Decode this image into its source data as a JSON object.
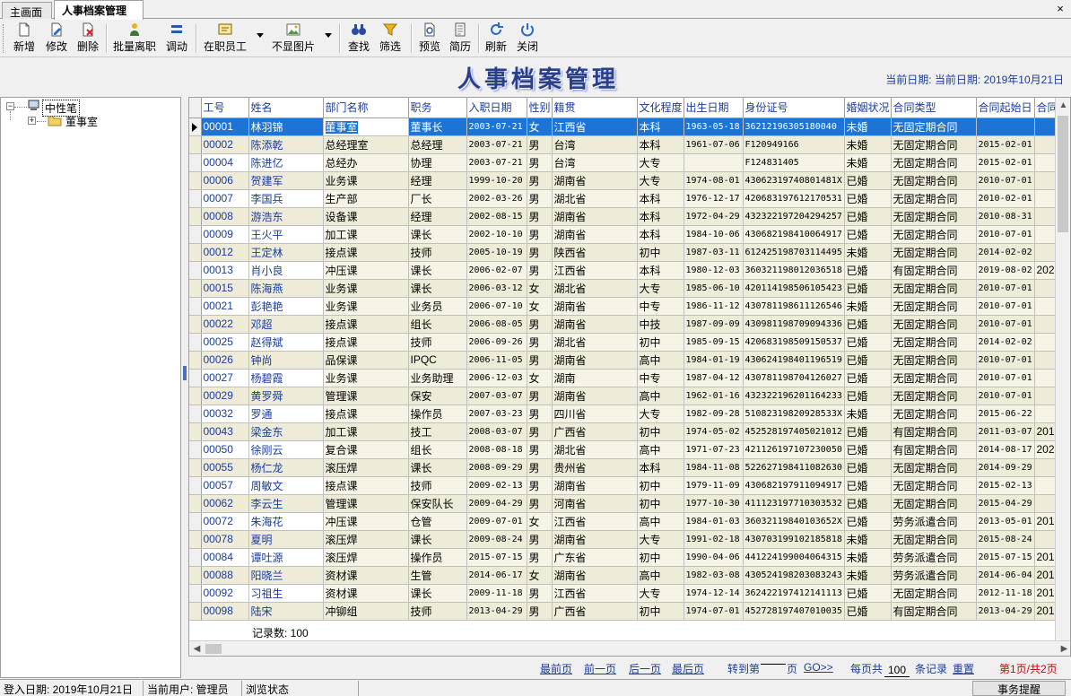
{
  "tabs": [
    "主画面",
    "人事档案管理"
  ],
  "close_glyph": "×",
  "toolbar": {
    "buttons": [
      {
        "label": "新增",
        "icon": "new-doc-icon"
      },
      {
        "label": "修改",
        "icon": "edit-doc-icon"
      },
      {
        "label": "删除",
        "icon": "delete-doc-icon"
      },
      {
        "label": "批量离职",
        "icon": "batch-leave-icon"
      },
      {
        "label": "调动",
        "icon": "transfer-icon"
      },
      {
        "label": "在职员工",
        "icon": "employee-status-icon"
      },
      {
        "label": "不显图片",
        "icon": "image-icon"
      },
      {
        "label": "查找",
        "icon": "binoculars-icon"
      },
      {
        "label": "筛选",
        "icon": "filter-icon"
      },
      {
        "label": "预览",
        "icon": "preview-icon"
      },
      {
        "label": "简历",
        "icon": "resume-icon"
      },
      {
        "label": "刷新",
        "icon": "refresh-icon"
      },
      {
        "label": "关闭",
        "icon": "power-icon"
      }
    ]
  },
  "banner": {
    "title": "人事档案管理",
    "current_date": "当前日期:  当前日期: 2019年10月21日"
  },
  "tree": {
    "root": "中性笔",
    "child": "董事室"
  },
  "grid": {
    "columns": [
      "工号",
      "姓名",
      "部门名称",
      "职务",
      "入职日期",
      "性别",
      "籍贯",
      "文化程度",
      "出生日期",
      "身份证号",
      "婚姻状况",
      "合同类型",
      "合同起始日",
      "合同"
    ],
    "rows": [
      [
        "00001",
        "林羽锦",
        "董事室",
        "董事长",
        "2003-07-21",
        "女",
        "江西省",
        "本科",
        "1963-05-18",
        "362121963051800​40",
        "未婚",
        "无固定期合同",
        "",
        ""
      ],
      [
        "00002",
        "陈添乾",
        "总经理室",
        "总经理",
        "2003-07-21",
        "男",
        "台湾",
        "本科",
        "1961-07-06",
        "F120949166",
        "未婚",
        "无固定期合同",
        "2015-02-01",
        ""
      ],
      [
        "00004",
        "陈进亿",
        "总经办",
        "协理",
        "2003-07-21",
        "男",
        "台湾",
        "大专",
        "",
        "F124831405",
        "未婚",
        "无固定期合同",
        "2015-02-01",
        ""
      ],
      [
        "00006",
        "贺建军",
        "业务课",
        "经理",
        "1999-10-20",
        "男",
        "湖南省",
        "大专",
        "1974-08-01",
        "430623197408​01481X",
        "已婚",
        "无固定期合同",
        "2010-07-01",
        ""
      ],
      [
        "00007",
        "李国兵",
        "生产部",
        "厂长",
        "2002-03-26",
        "男",
        "湖北省",
        "本科",
        "1976-12-17",
        "420683197612170531",
        "已婚",
        "无固定期合同",
        "2010-02-01",
        ""
      ],
      [
        "00008",
        "游浩东",
        "设备课",
        "经理",
        "2002-08-15",
        "男",
        "湖南省",
        "本科",
        "1972-04-29",
        "432322197204294257",
        "已婚",
        "无固定期合同",
        "2010-08-31",
        ""
      ],
      [
        "00009",
        "王火平",
        "加工课",
        "课长",
        "2002-10-10",
        "男",
        "湖南省",
        "本科",
        "1984-10-06",
        "430682198410064917",
        "已婚",
        "无固定期合同",
        "2010-07-01",
        ""
      ],
      [
        "00012",
        "王定林",
        "接点课",
        "技师",
        "2005-10-19",
        "男",
        "陕西省",
        "初中",
        "1987-03-11",
        "612425198703114495",
        "未婚",
        "无固定期合同",
        "2014-02-02",
        ""
      ],
      [
        "00013",
        "肖小良",
        "冲压课",
        "课长",
        "2006-02-07",
        "男",
        "江西省",
        "本科",
        "1980-12-03",
        "360321198012036518",
        "已婚",
        "有固定期合同",
        "2019-08-02",
        "202"
      ],
      [
        "00015",
        "陈海燕",
        "业务课",
        "课长",
        "2006-03-12",
        "女",
        "湖北省",
        "大专",
        "1985-06-10",
        "420114198506105423",
        "已婚",
        "无固定期合同",
        "2010-07-01",
        ""
      ],
      [
        "00021",
        "彭艳艳",
        "业务课",
        "业务员",
        "2006-07-10",
        "女",
        "湖南省",
        "中专",
        "1986-11-12",
        "430781198611126546",
        "未婚",
        "无固定期合同",
        "2010-07-01",
        ""
      ],
      [
        "00022",
        "邓超",
        "接点课",
        "组长",
        "2006-08-05",
        "男",
        "湖南省",
        "中技",
        "1987-09-09",
        "430981198709094336",
        "已婚",
        "无固定期合同",
        "2010-07-01",
        ""
      ],
      [
        "00025",
        "赵得斌",
        "接点课",
        "技师",
        "2006-09-26",
        "男",
        "湖北省",
        "初中",
        "1985-09-15",
        "420683198509150537",
        "已婚",
        "无固定期合同",
        "2014-02-02",
        ""
      ],
      [
        "00026",
        "钟尚",
        "品保课",
        "IPQC",
        "2006-11-05",
        "男",
        "湖南省",
        "高中",
        "1984-01-19",
        "430624198401196519",
        "已婚",
        "无固定期合同",
        "2010-07-01",
        ""
      ],
      [
        "00027",
        "杨碧霞",
        "业务课",
        "业务助理",
        "2006-12-03",
        "女",
        "湖南",
        "中专",
        "1987-04-12",
        "430781198704126027",
        "已婚",
        "无固定期合同",
        "2010-07-01",
        ""
      ],
      [
        "00029",
        "黄罗舜",
        "管理课",
        "保安",
        "2007-03-07",
        "男",
        "湖南省",
        "高中",
        "1962-01-16",
        "432322196201164233",
        "已婚",
        "无固定期合同",
        "2010-07-01",
        ""
      ],
      [
        "00032",
        "罗通",
        "接点课",
        "操作员",
        "2007-03-23",
        "男",
        "四川省",
        "大专",
        "1982-09-28",
        "51082319820928533X",
        "未婚",
        "无固定期合同",
        "2015-06-22",
        ""
      ],
      [
        "00043",
        "梁金东",
        "加工课",
        "技工",
        "2008-03-07",
        "男",
        "广西省",
        "初中",
        "1974-05-02",
        "452528197405021012",
        "已婚",
        "有固定期合同",
        "2011-03-07",
        "201"
      ],
      [
        "00050",
        "徐刚云",
        "复合课",
        "组长",
        "2008-08-18",
        "男",
        "湖北省",
        "高中",
        "1971-07-23",
        "421126197107230050",
        "已婚",
        "有固定期合同",
        "2014-08-17",
        "202"
      ],
      [
        "00055",
        "杨仁龙",
        "滚压焊",
        "课长",
        "2008-09-29",
        "男",
        "贵州省",
        "本科",
        "1984-11-08",
        "522627198411082630",
        "已婚",
        "无固定期合同",
        "2014-09-29",
        ""
      ],
      [
        "00057",
        "周敏文",
        "接点课",
        "技师",
        "2009-02-13",
        "男",
        "湖南省",
        "初中",
        "1979-11-09",
        "430682197911094917",
        "已婚",
        "无固定期合同",
        "2015-02-13",
        ""
      ],
      [
        "00062",
        "李云生",
        "管理课",
        "保安队长",
        "2009-04-29",
        "男",
        "河南省",
        "初中",
        "1977-10-30",
        "411123197710303532",
        "已婚",
        "无固定期合同",
        "2015-04-29",
        ""
      ],
      [
        "00072",
        "朱海花",
        "冲压课",
        "仓管",
        "2009-07-01",
        "女",
        "江西省",
        "高中",
        "1984-01-03",
        "36032119840103652X",
        "已婚",
        "劳务派遣合同",
        "2013-05-01",
        "201"
      ],
      [
        "00078",
        "夏明",
        "滚压焊",
        "课长",
        "2009-08-24",
        "男",
        "湖南省",
        "大专",
        "1991-02-18",
        "430703199102185818",
        "未婚",
        "无固定期合同",
        "2015-08-24",
        ""
      ],
      [
        "00084",
        "谭吐源",
        "滚压焊",
        "操作员",
        "2015-07-15",
        "男",
        "广东省",
        "初中",
        "1990-04-06",
        "441224199004064315",
        "未婚",
        "劳务派遣合同",
        "2015-07-15",
        "201"
      ],
      [
        "00088",
        "阳晓兰",
        "资材课",
        "生管",
        "2014-06-17",
        "女",
        "湖南省",
        "高中",
        "1982-03-08",
        "430524198203083243",
        "未婚",
        "劳务派遣合同",
        "2014-06-04",
        "201"
      ],
      [
        "00092",
        "习祖生",
        "资材课",
        "课长",
        "2009-11-18",
        "男",
        "江西省",
        "大专",
        "1974-12-14",
        "362422197412141113",
        "已婚",
        "无固定期合同",
        "2012-11-18",
        "201"
      ],
      [
        "00098",
        "陆宋",
        "冲铆组",
        "技师",
        "2013-04-29",
        "男",
        "广西省",
        "初中",
        "1974-07-01",
        "452728197407010035",
        "已婚",
        "有固定期合同",
        "2013-04-29",
        "201"
      ]
    ],
    "record_count": "记录数: 100"
  },
  "pager": {
    "first": "最前页",
    "prev": "前一页",
    "next": "后一页",
    "last": "最后页",
    "goto_prefix": "转到第",
    "goto_suffix": "页",
    "go": "GO>>",
    "per_page_prefix": "每页共",
    "per_page_value": "100",
    "per_page_suffix": "条记录",
    "reset": "重置",
    "page_info": "第1页/共2页"
  },
  "status": {
    "login_date": "登入日期: 2019年10月21日",
    "user": "当前用户: 管理员",
    "mode": "浏览状态",
    "remind": "事务提醒"
  },
  "colors": {
    "selection": "#1b74d6",
    "link": "#1a3da0",
    "row_bg": "#f7f4e6",
    "page_info": "#d00000"
  }
}
